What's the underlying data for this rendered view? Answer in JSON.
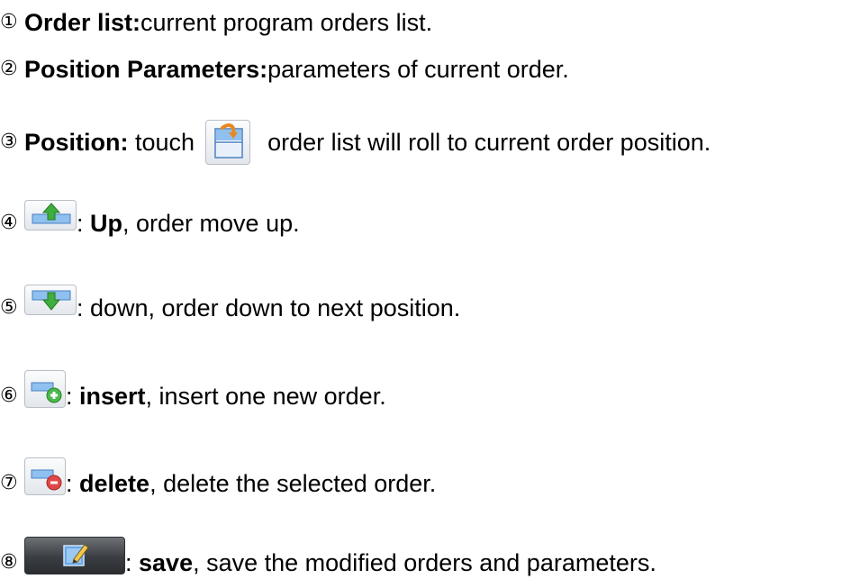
{
  "items": [
    {
      "num": "①",
      "term": "Order list:",
      "desc": " current program orders list."
    },
    {
      "num": "②",
      "term": "Position Parameters:",
      "desc": " parameters of current order."
    },
    {
      "num": "③",
      "term": "Position:",
      "pre": " touch ",
      "desc": " order list will roll to current order position.",
      "icon": "position-icon"
    },
    {
      "num": "④",
      "sep": ": ",
      "term": "Up",
      "desc": ", order move up.",
      "icon": "up-arrow-icon"
    },
    {
      "num": "⑤",
      "sep": ": down, order down to next position.",
      "icon": "down-arrow-icon"
    },
    {
      "num": "⑥",
      "sep": ": ",
      "term": "insert",
      "desc": ", insert one new order.",
      "icon": "insert-plus-icon"
    },
    {
      "num": "⑦",
      "sep": ": ",
      "term": "delete",
      "desc": ", delete the selected order.",
      "icon": "delete-minus-icon"
    },
    {
      "num": "⑧",
      "sep": ": ",
      "term": "save",
      "desc": ", save the modified orders and parameters.",
      "icon": "save-edit-icon"
    }
  ]
}
